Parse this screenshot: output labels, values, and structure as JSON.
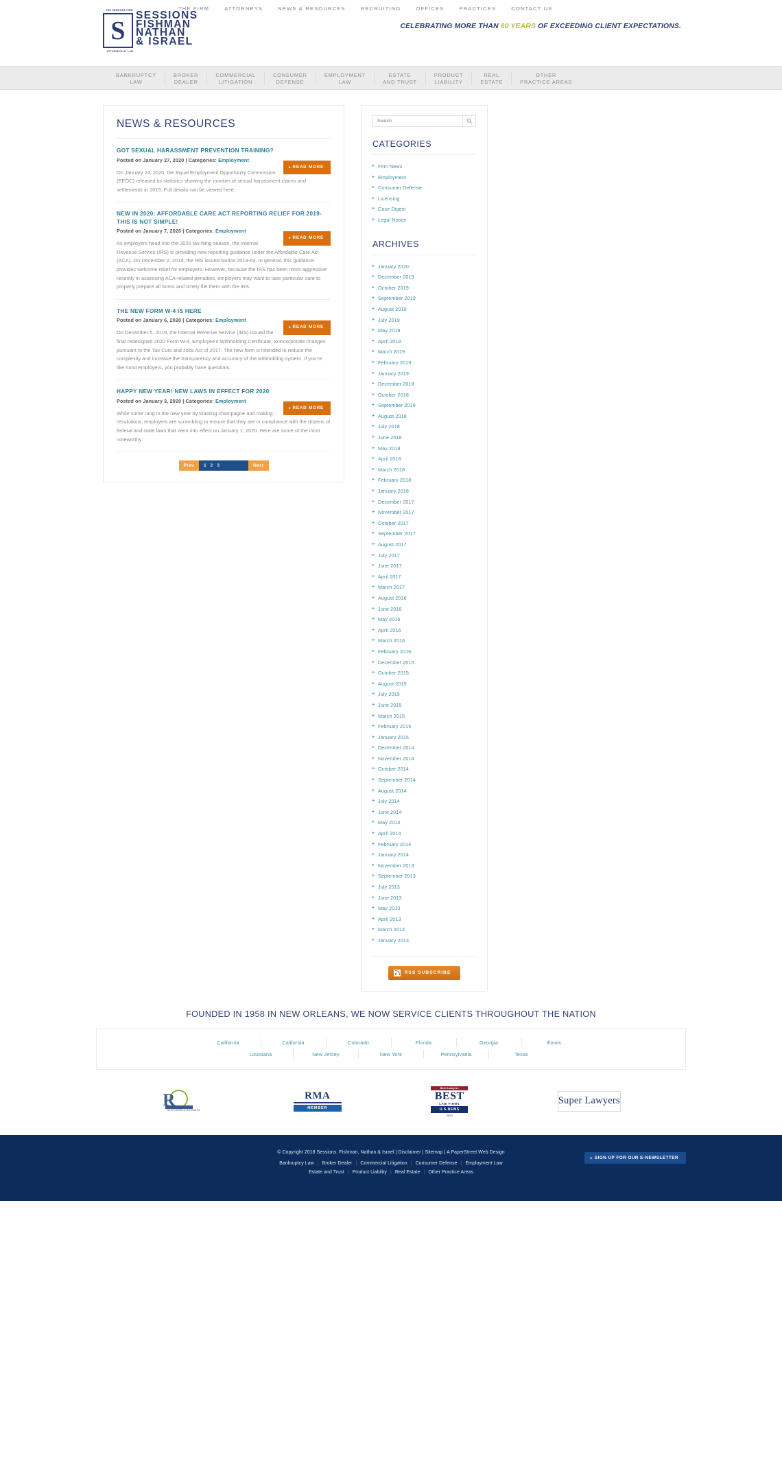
{
  "header": {
    "logo": {
      "top_tag": "THE SESSIONS FIRM",
      "glyph": "S",
      "bottom_tag": "ATTORNEYS AT LAW",
      "line1": "SESSIONS",
      "line2": "FISHMAN",
      "line3": "NATHAN",
      "line4": "& ISRAEL"
    },
    "nav": [
      "THE FIRM",
      "ATTORNEYS",
      "NEWS & RESOURCES",
      "RECRUITING",
      "OFFICES",
      "PRACTICES",
      "CONTACT US"
    ],
    "tagline_before": "CELEBRATING MORE THAN ",
    "tagline_years": "60 YEARS",
    "tagline_after": " OF EXCEEDING CLIENT EXPECTATIONS."
  },
  "practice_bar": [
    {
      "line1": "BANKRUPTCY",
      "line2": "LAW"
    },
    {
      "line1": "BROKER",
      "line2": "DEALER"
    },
    {
      "line1": "COMMERCIAL",
      "line2": "LITIGATION"
    },
    {
      "line1": "CONSUMER",
      "line2": "DEFENSE"
    },
    {
      "line1": "EMPLOYMENT",
      "line2": "LAW"
    },
    {
      "line1": "ESTATE",
      "line2": "AND TRUST"
    },
    {
      "line1": "PRODUCT",
      "line2": "LIABILITY"
    },
    {
      "line1": "REAL",
      "line2": "ESTATE"
    },
    {
      "line1": "OTHER",
      "line2": "PRACTICE AREAS"
    }
  ],
  "main": {
    "title": "NEWS & RESOURCES",
    "read_more_label": "READ MORE",
    "posts": [
      {
        "title": "GOT SEXUAL HARASSMENT PREVENTION TRAINING?",
        "meta_prefix": "Posted on January 27, 2020 | Categories: ",
        "category": "Employment",
        "body": "On January 24, 2020, the Equal Employment Opportunity Commission (EEOC) released its statistics showing the number of sexual harassment claims and settlements in 2019. Full details can be viewed here."
      },
      {
        "title": "NEW IN 2020: AFFORDABLE CARE ACT REPORTING RELIEF FOR 2019- THIS IS NOT SIMPLE!",
        "meta_prefix": "Posted on January 7, 2020 | Categories: ",
        "category": "Employment",
        "body": "As employers head into the 2020 tax-filing season, the Internal Revenue Service (IRS) is providing new reporting guidance under the Affordable Care Act (ACA).  On December 2, 2019, the IRS issued Notice 2019-63.  In general, this guidance provides welcome relief for employers. However, because the IRS has been more aggressive recently in assessing ACA-related penalties, employers may want to take particular care to properly prepare all forms and timely file them with the IRS."
      },
      {
        "title": "THE NEW FORM W-4 IS HERE",
        "meta_prefix": "Posted on January 6, 2020 | Categories: ",
        "category": "Employment",
        "body": "On December 5, 2019, the Internal Revenue Service (IRS) issued the final redesigned 2020 Form W-4, Employee's Withholding Certificate, to incorporate changes pursuant to the Tax Cuts and Jobs Act of 2017. The new form is intended to reduce the complexity and increase the transparency and accuracy of the withholding system.  If you're like most employers, you probably have questions."
      },
      {
        "title": "HAPPY NEW YEAR! NEW LAWS IN EFFECT FOR 2020",
        "meta_prefix": "Posted on January 3, 2020 | Categories: ",
        "category": "Employment",
        "body": "While some rang in the new year by toasting champagne and making resolutions, employers are scrambling to ensure that they are in compliance with the dozens of federal and state laws that went into effect on January 1, 2020.  Here are some of the most noteworthy:"
      }
    ],
    "pagination": {
      "prev_label": "Prev",
      "next_label": "Next",
      "pages": [
        "1",
        "2",
        "3"
      ],
      "current": "1"
    }
  },
  "sidebar": {
    "search_placeholder": "Search",
    "search_value": "",
    "categories_title": "CATEGORIES",
    "categories": [
      "Firm News",
      "Employment",
      "Consumer Defense",
      "Licensing",
      "Case Digest",
      "Legal Notice"
    ],
    "archives_title": "ARCHIVES",
    "archives": [
      "January 2020",
      "December 2019",
      "October 2019",
      "September 2019",
      "August 2019",
      "July 2019",
      "May 2019",
      "April 2019",
      "March 2019",
      "February 2019",
      "January 2019",
      "December 2018",
      "October 2018",
      "September 2018",
      "August 2018",
      "July 2018",
      "June 2018",
      "May 2018",
      "April 2018",
      "March 2018",
      "February 2018",
      "January 2018",
      "December 2017",
      "November 2017",
      "October 2017",
      "September 2017",
      "August 2017",
      "July 2017",
      "June 2017",
      "April 2017",
      "March 2017",
      "August 2016",
      "June 2016",
      "May 2016",
      "April 2016",
      "March 2016",
      "February 2016",
      "December 2015",
      "October 2015",
      "August 2015",
      "July 2015",
      "June 2015",
      "March 2015",
      "February 2015",
      "January 2015",
      "December 2014",
      "November 2014",
      "October 2014",
      "September 2014",
      "August 2014",
      "July 2014",
      "June 2014",
      "May 2014",
      "April 2014",
      "February 2014",
      "January 2014",
      "November 2013",
      "September 2013",
      "July 2013",
      "June 2013",
      "May 2013",
      "April 2013",
      "March 2013",
      "January 2013"
    ],
    "rss_label": "RSS SUBSCRIBE"
  },
  "nation": {
    "title": "FOUNDED IN 1958 IN NEW ORLEANS, WE NOW SERVICE CLIENTS THROUGHOUT THE NATION",
    "row1": [
      "California",
      "California",
      "Colorado",
      "Florida",
      "Georgia",
      "Illinois"
    ],
    "row2": [
      "Louisiana",
      "New Jersey",
      "New York",
      "Pennsylvania",
      "Texas"
    ]
  },
  "badges": {
    "r_sub": "RESPONSIBLE BUSINESS",
    "r_letter": "R",
    "rma_top": "RMA",
    "rma_member": "MEMBER",
    "best_top": "Best Lawyers",
    "best_mid": "BEST",
    "best_sub": "LAW FIRMS",
    "best_bot": "U.S.NEWS",
    "best_year": "2020",
    "super_lawyers": "Super Lawyers"
  },
  "footer": {
    "copyright": "© Copyright 2018 Sessions, Fishman, Nathan & Israel | Disclaimer | Sitemap | A PaperStreet Web Design",
    "links_row1": [
      "Bankruptcy Law",
      "Broker Dealer",
      "Commercial Litigation",
      "Consumer Defense",
      "Employment Law"
    ],
    "links_row2": [
      "Estate and Trust",
      "Product Liability",
      "Real Estate",
      "Other Practice Areas"
    ],
    "newsletter_label": "SIGN UP FOR OUR E-NEWSLETTER"
  }
}
